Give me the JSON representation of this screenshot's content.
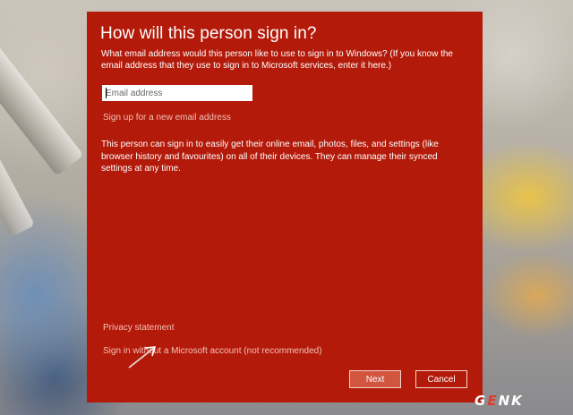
{
  "dialog": {
    "title": "How will this person sign in?",
    "prompt": "What email address would this person like to use to sign in to Windows? (If you know the email address that they use to sign in to Microsoft services, enter it here.)",
    "email_placeholder": "Email address",
    "email_value": "",
    "signup_link": "Sign up for a new email address",
    "info": "This person can sign in to easily get their online email, photos, files, and settings (like browser history and favourites) on all of their devices. They can manage their synced settings at any time.",
    "privacy_link": "Privacy statement",
    "no_msa_link": "Sign in without a Microsoft account (not recommended)",
    "next_label": "Next",
    "cancel_label": "Cancel"
  },
  "watermark": {
    "prefix": "G",
    "accent": "E",
    "suffix": "NK"
  },
  "colors": {
    "dialog_bg": "#b31a0a",
    "link": "#f3c2b6",
    "next_bg": "#d2553f",
    "logo_accent": "#e23b2a"
  }
}
